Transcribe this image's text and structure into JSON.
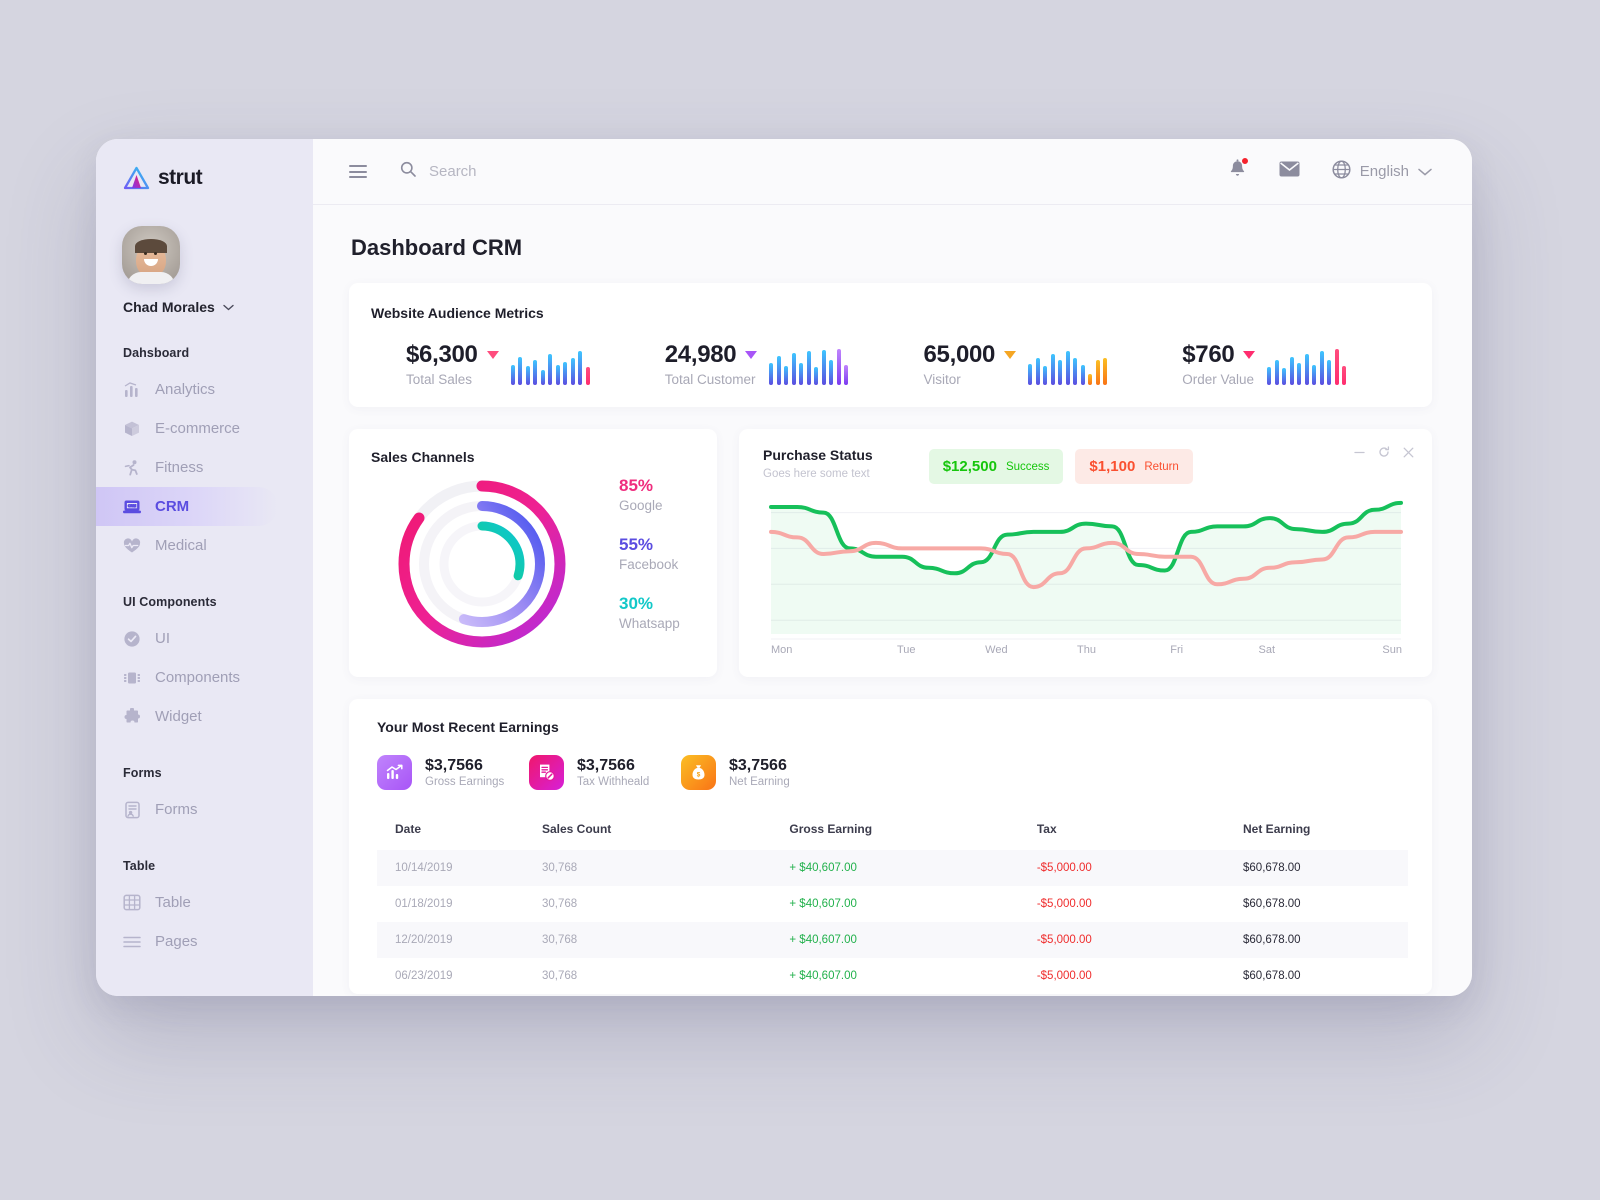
{
  "brand": {
    "name": "strut",
    "logo_icon": "triangle-logo-icon"
  },
  "sidebar": {
    "user": {
      "name": "Chad Morales",
      "chevron_icon": "chevron-down-icon",
      "avatar_icon": "avatar"
    },
    "sections": [
      {
        "title": "Dahsboard",
        "items": [
          {
            "label": "Analytics",
            "icon": "bar-chart-icon",
            "active": false
          },
          {
            "label": "E-commerce",
            "icon": "box-icon",
            "active": false
          },
          {
            "label": "Fitness",
            "icon": "running-icon",
            "active": false
          },
          {
            "label": "CRM",
            "icon": "crm-laptop-icon",
            "active": true
          },
          {
            "label": "Medical",
            "icon": "heartbeat-icon",
            "active": false
          }
        ]
      },
      {
        "title": "UI Components",
        "items": [
          {
            "label": "UI",
            "icon": "check-circle-icon",
            "active": false
          },
          {
            "label": "Components",
            "icon": "components-icon",
            "active": false
          },
          {
            "label": "Widget",
            "icon": "puzzle-icon",
            "active": false
          }
        ]
      },
      {
        "title": "Forms",
        "items": [
          {
            "label": "Forms",
            "icon": "form-icon",
            "active": false
          }
        ]
      },
      {
        "title": "Table",
        "items": [
          {
            "label": "Table",
            "icon": "table-grid-icon",
            "active": false
          },
          {
            "label": "Pages",
            "icon": "list-lines-icon",
            "active": false
          }
        ]
      }
    ]
  },
  "topbar": {
    "menu_icon": "hamburger-menu-icon",
    "search_icon": "search-icon",
    "search_placeholder": "Search",
    "search_value": "",
    "notifications_icon": "bell-icon",
    "mail_icon": "envelope-icon",
    "globe_icon": "globe-icon",
    "language": "English",
    "language_chevron_icon": "chevron-down-icon"
  },
  "page": {
    "title": "Dashboard CRM"
  },
  "metrics": {
    "title": "Website Audience Metrics",
    "items": [
      {
        "value": "$6,300",
        "label": "Total Sales",
        "trend": "down",
        "trend_color": "#ff4d7e",
        "bars": [
          48,
          72,
          45,
          62,
          30,
          82,
          48,
          56,
          70,
          95,
          40
        ],
        "bar_colors": [
          "grad-blue",
          "grad-blue",
          "grad-blue",
          "grad-blue",
          "grad-blue",
          "grad-blue",
          "grad-blue",
          "grad-blue",
          "grad-blue",
          "grad-blue",
          "pink"
        ]
      },
      {
        "value": "24,980",
        "label": "Total Customer",
        "trend": "down",
        "trend_color": "#a855f7",
        "bars": [
          52,
          78,
          42,
          88,
          55,
          92,
          40,
          96,
          62,
          100,
          48
        ],
        "bar_colors": [
          "grad-blue",
          "grad-blue",
          "grad-blue",
          "grad-blue",
          "grad-blue",
          "grad-blue",
          "grad-blue",
          "grad-blue",
          "grad-blue",
          "purple",
          "purple"
        ]
      },
      {
        "value": "65,000",
        "label": "Visitor",
        "trend": "down",
        "trend_color": "#f5a623",
        "bars": [
          50,
          70,
          45,
          85,
          62,
          92,
          70,
          48,
          18,
          62,
          70
        ],
        "bar_colors": [
          "grad-blue",
          "grad-blue",
          "grad-blue",
          "grad-blue",
          "grad-blue",
          "grad-blue",
          "grad-blue",
          "grad-blue",
          "orange",
          "orange",
          "orange"
        ]
      },
      {
        "value": "$760",
        "label": "Order Value",
        "trend": "down",
        "trend_color": "#ff2d6f",
        "bars": [
          40,
          62,
          38,
          72,
          55,
          82,
          48,
          92,
          62,
          100,
          45
        ],
        "bar_colors": [
          "grad-blue",
          "grad-blue",
          "grad-blue",
          "grad-blue",
          "grad-blue",
          "grad-blue",
          "grad-blue",
          "grad-blue",
          "grad-blue",
          "pink",
          "pink"
        ]
      }
    ]
  },
  "sales_channels": {
    "title": "Sales Channels",
    "legend": [
      {
        "pct": "85%",
        "name": "Google",
        "color": "#ef2d7e"
      },
      {
        "pct": "55%",
        "name": "Facebook",
        "color": "#5b4de0"
      },
      {
        "pct": "30%",
        "name": "Whatsapp",
        "color": "#12c8c8"
      }
    ]
  },
  "purchase_status": {
    "title": "Purchase Status",
    "subtitle": "Goes here some text",
    "pills": [
      {
        "value": "$12,500",
        "label": "Success",
        "color": "#16c60c",
        "bg": "#e4f8e4"
      },
      {
        "value": "$1,100",
        "label": "Return",
        "color": "#fa5030",
        "bg": "#fdeae6"
      }
    ],
    "window_controls": [
      {
        "icon": "minimize-icon"
      },
      {
        "icon": "refresh-icon"
      },
      {
        "icon": "close-icon"
      }
    ]
  },
  "earnings": {
    "title": "Your Most Recent Earnings",
    "stats": [
      {
        "value": "$3,7566",
        "label": "Gross Earnings",
        "icon": "growth-chart-icon",
        "grad": "linear-gradient(135deg,#c084fc,#a855f7)"
      },
      {
        "value": "$3,7566",
        "label": "Tax Withheald",
        "icon": "tax-invoice-icon",
        "grad": "linear-gradient(135deg,#f0176b,#d620d9)"
      },
      {
        "value": "$3,7566",
        "label": "Net Earning",
        "icon": "money-bag-icon",
        "grad": "linear-gradient(135deg,#fbbf24,#f97316)"
      }
    ],
    "table": {
      "columns": [
        "Date",
        "Sales Count",
        "Gross Earning",
        "Tax",
        "Net Earning"
      ],
      "rows": [
        {
          "date": "10/14/2019",
          "sales_count": "30,768",
          "gross": "+ $40,607.00",
          "tax": "-$5,000.00",
          "net": "$60,678.00"
        },
        {
          "date": "01/18/2019",
          "sales_count": "30,768",
          "gross": "+ $40,607.00",
          "tax": "-$5,000.00",
          "net": "$60,678.00"
        },
        {
          "date": "12/20/2019",
          "sales_count": "30,768",
          "gross": "+ $40,607.00",
          "tax": "-$5,000.00",
          "net": "$60,678.00"
        },
        {
          "date": "06/23/2019",
          "sales_count": "30,768",
          "gross": "+ $40,607.00",
          "tax": "-$5,000.00",
          "net": "$60,678.00"
        }
      ]
    }
  },
  "chart_data": [
    {
      "type": "pie",
      "title": "Sales Channels",
      "chart_style": "concentric-radial-gauge",
      "categories": [
        "Google",
        "Facebook",
        "Whatsapp"
      ],
      "values": [
        85,
        55,
        30
      ],
      "unit": "%",
      "colors": [
        "#ef2d7e",
        "#5b4de0",
        "#12c8c8"
      ],
      "legend": "right",
      "grid": false
    },
    {
      "type": "area",
      "title": "Purchase Status",
      "subtitle": "Goes here some text",
      "x": [
        "Mon",
        "Tue",
        "Wed",
        "Thu",
        "Fri",
        "Sat",
        "Sun"
      ],
      "xlabel": "",
      "ylabel": "",
      "ylim": [
        0,
        100
      ],
      "grid": true,
      "legend": "none",
      "series": [
        {
          "name": "Success",
          "color": "#16c05a",
          "values": [
            92,
            56,
            48,
            74,
            62,
            80,
            95
          ],
          "dense_values": [
            92,
            92,
            88,
            62,
            56,
            56,
            48,
            44,
            52,
            72,
            74,
            74,
            80,
            78,
            50,
            46,
            74,
            78,
            78,
            84,
            76,
            74,
            80,
            90,
            95
          ],
          "fill": "rgba(22,192,90,0.07)"
        },
        {
          "name": "Return",
          "color": "#f7a9a5",
          "values": [
            74,
            62,
            64,
            60,
            56,
            46,
            74
          ],
          "dense_values": [
            74,
            70,
            58,
            60,
            66,
            62,
            62,
            62,
            62,
            58,
            34,
            44,
            62,
            66,
            58,
            56,
            56,
            36,
            40,
            48,
            52,
            54,
            70,
            74,
            74
          ],
          "fill": "none"
        }
      ]
    },
    {
      "type": "bar",
      "title": "Website Audience Metrics — sparklines",
      "categories": [
        "Total Sales",
        "Total Customer",
        "Visitor",
        "Order Value"
      ],
      "values": [
        6300,
        24980,
        65000,
        760
      ],
      "value_labels": [
        "$6,300",
        "24,980",
        "65,000",
        "$760"
      ],
      "grid": false,
      "legend": "none"
    }
  ]
}
